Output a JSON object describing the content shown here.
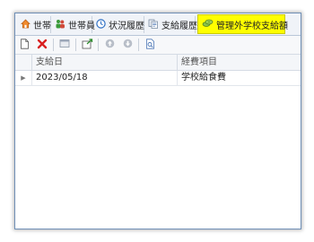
{
  "tabs": [
    {
      "label": "世帯",
      "icon": "house-icon"
    },
    {
      "label": "世帯員",
      "icon": "people-icon"
    },
    {
      "label": "状況履歴",
      "icon": "clock-icon"
    },
    {
      "label": "支給履歴",
      "icon": "documents-icon"
    },
    {
      "label": "管理外学校支給額",
      "icon": "money-icon",
      "active": true
    }
  ],
  "toolbar": {
    "buttons": [
      "new-icon",
      "delete-icon",
      "window-icon",
      "export-icon",
      "move-up-icon",
      "move-down-icon",
      "preview-icon"
    ]
  },
  "grid": {
    "columns": [
      "支給日",
      "経費項目"
    ],
    "rows": [
      {
        "date": "2023/05/18",
        "item": "学校給食費"
      }
    ]
  },
  "colors": {
    "active_tab_highlight": "#ffff00",
    "frame_border": "#6f8fb6"
  }
}
